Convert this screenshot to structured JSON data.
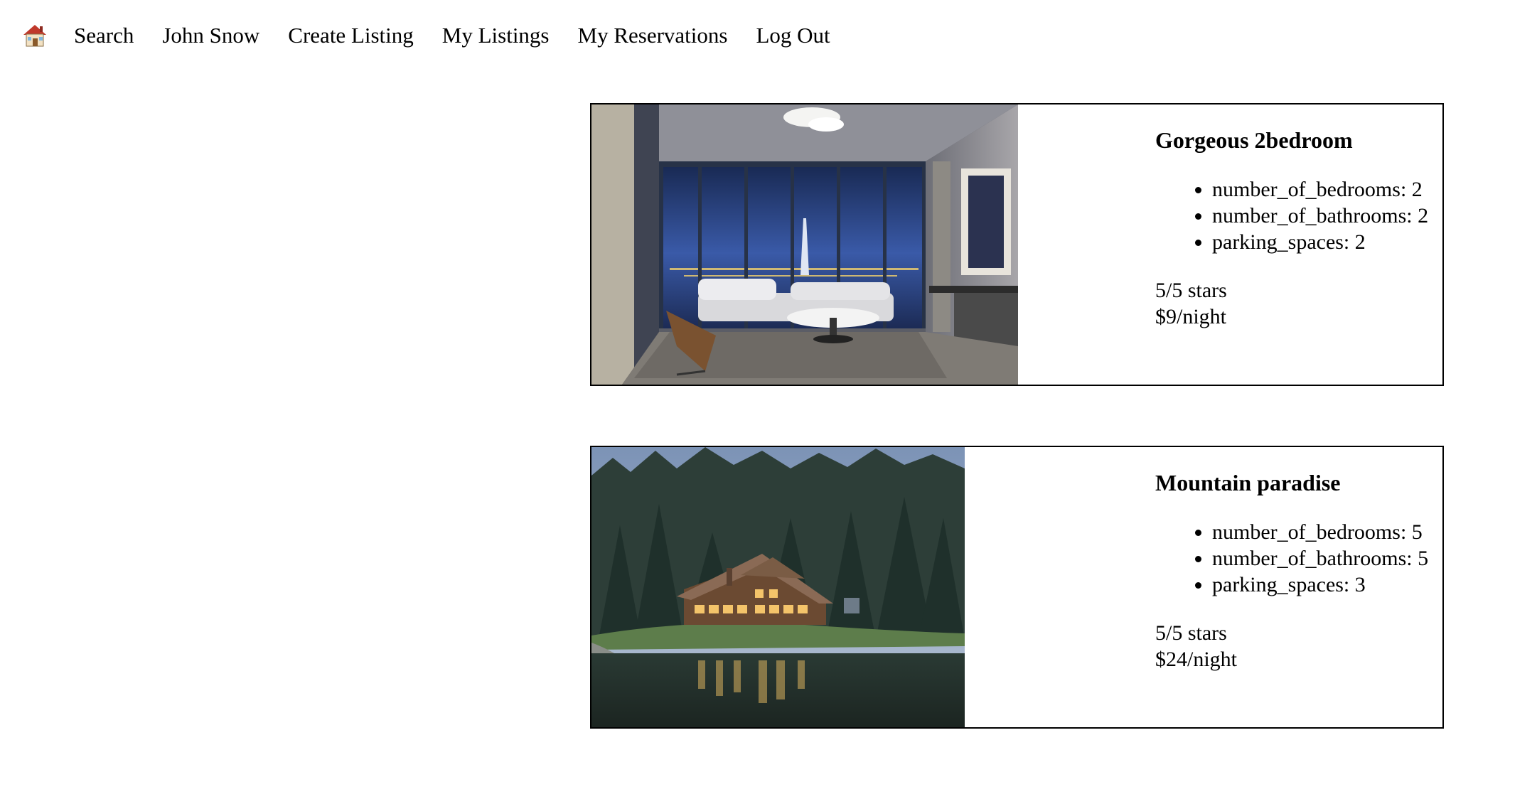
{
  "nav": {
    "home_icon": "house-icon",
    "items": [
      "Search",
      "John Snow",
      "Create Listing",
      "My Listings",
      "My Reservations",
      "Log Out"
    ]
  },
  "listings": [
    {
      "title": "Gorgeous 2bedroom",
      "features": [
        "number_of_bedrooms: 2",
        "number_of_bathrooms: 2",
        "parking_spaces: 2"
      ],
      "rating": "5/5 stars",
      "price": "$9/night",
      "image": "apartment-living-room-photo"
    },
    {
      "title": "Mountain paradise",
      "features": [
        "number_of_bedrooms: 5",
        "number_of_bathrooms: 5",
        "parking_spaces: 3"
      ],
      "rating": "5/5 stars",
      "price": "$24/night",
      "image": "lake-cabin-photo"
    }
  ]
}
